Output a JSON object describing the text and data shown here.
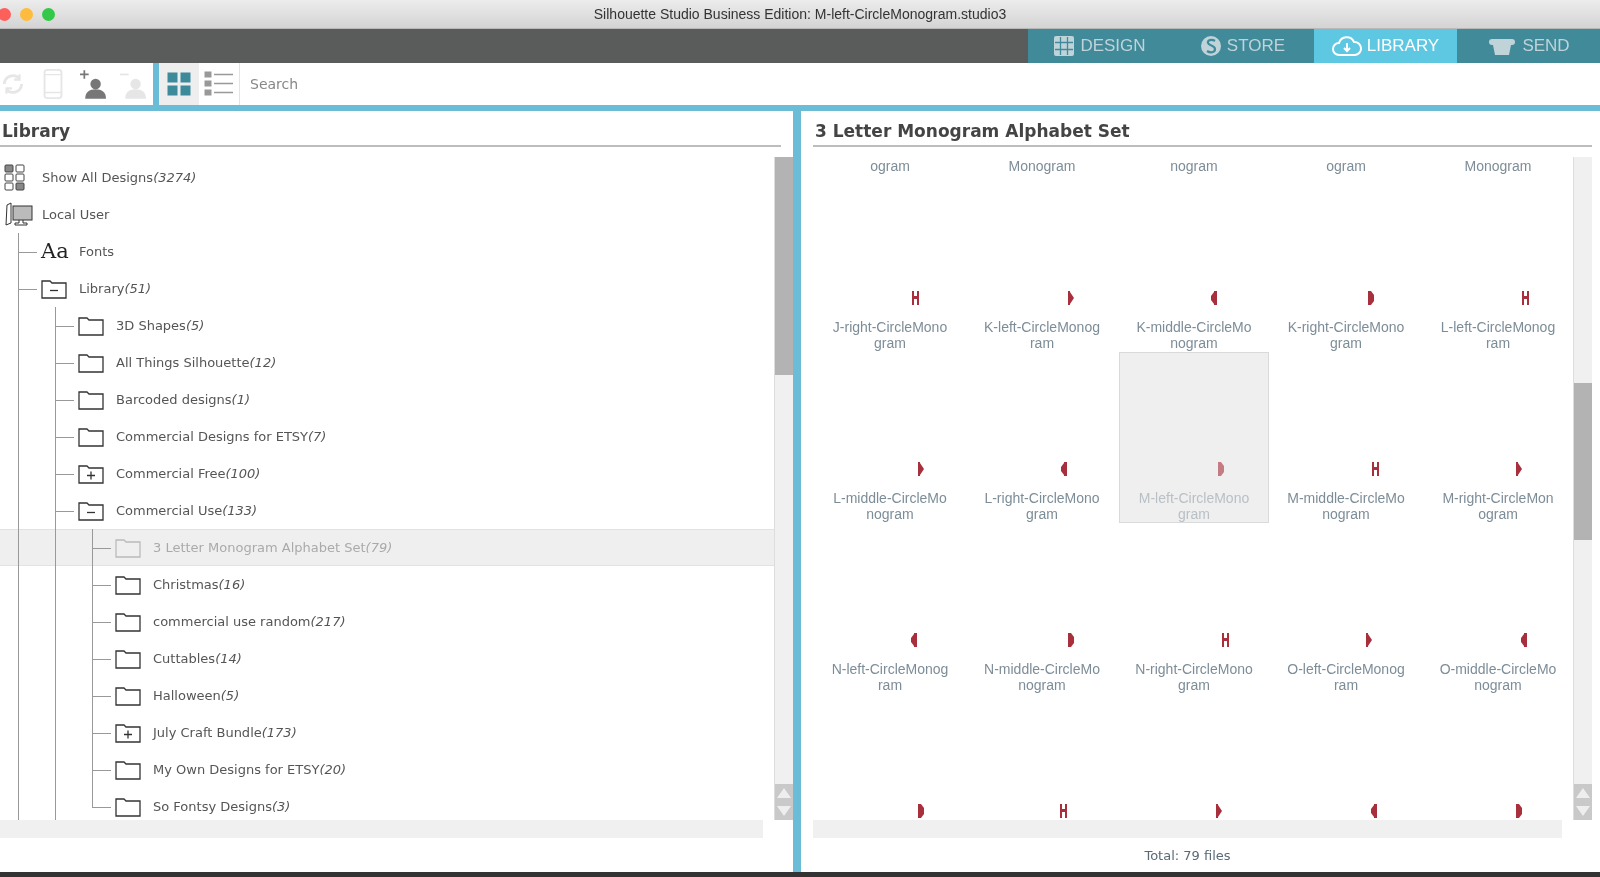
{
  "window": {
    "title": "Silhouette Studio Business Edition: M-left-CircleMonogram.studio3"
  },
  "nav_tabs": [
    {
      "label": "DESIGN",
      "kind": "design",
      "selected": false
    },
    {
      "label": "STORE",
      "kind": "store",
      "selected": false
    },
    {
      "label": "LIBRARY",
      "kind": "library",
      "selected": true
    },
    {
      "label": "SEND",
      "kind": "send",
      "selected": false
    }
  ],
  "toolbar": {
    "tools": [
      {
        "kind": "sync",
        "disabled": true
      },
      {
        "kind": "device",
        "disabled": true
      },
      {
        "kind": "add-user",
        "disabled": false
      },
      {
        "kind": "remove-user",
        "disabled": true
      }
    ],
    "views": [
      {
        "kind": "grid",
        "selected": true
      },
      {
        "kind": "list",
        "selected": false
      }
    ],
    "search": {
      "placeholder": "Search"
    }
  },
  "library_panel": {
    "title": "Library",
    "tree": [
      {
        "name": "Show All Designs",
        "count": "(3274)",
        "kind": "all",
        "selected": false
      },
      {
        "name": "Local User",
        "kind": "user",
        "selected": false,
        "children": [
          {
            "name": "Fonts",
            "kind": "fonts",
            "icon_text": "Aa",
            "selected": false
          },
          {
            "name": "Library",
            "count": "(51)",
            "kind": "folder-expanded",
            "selected": false,
            "children": [
              {
                "name": "3D Shapes",
                "count": "(5)",
                "kind": "folder",
                "selected": false
              },
              {
                "name": "All Things Silhouette",
                "count": "(12)",
                "kind": "folder",
                "selected": false
              },
              {
                "name": "Barcoded designs",
                "count": "(1)",
                "kind": "folder",
                "selected": false
              },
              {
                "name": "Commercial Designs for ETSY",
                "count": "(7)",
                "kind": "folder",
                "selected": false
              },
              {
                "name": "Commercial Free",
                "count": "(100)",
                "kind": "folder-collapsed",
                "selected": false
              },
              {
                "name": "Commercial Use",
                "count": "(133)",
                "kind": "folder-expanded",
                "selected": false,
                "children": [
                  {
                    "name": "3 Letter Monogram Alphabet Set",
                    "count": "(79)",
                    "kind": "folder",
                    "selected": true
                  },
                  {
                    "name": "Christmas",
                    "count": "(16)",
                    "kind": "folder",
                    "selected": false
                  },
                  {
                    "name": "commercial use random",
                    "count": "(217)",
                    "kind": "folder",
                    "selected": false
                  },
                  {
                    "name": "Cuttables",
                    "count": "(14)",
                    "kind": "folder",
                    "selected": false
                  },
                  {
                    "name": "Halloween",
                    "count": "(5)",
                    "kind": "folder",
                    "selected": false
                  },
                  {
                    "name": "July Craft Bundle",
                    "count": "(173)",
                    "kind": "folder-collapsed",
                    "selected": false
                  },
                  {
                    "name": "My Own Designs for ETSY",
                    "count": "(20)",
                    "kind": "folder",
                    "selected": false
                  },
                  {
                    "name": "So Fontsy Designs",
                    "count": "(3)",
                    "kind": "folder",
                    "selected": false
                  }
                ]
              }
            ]
          }
        ]
      }
    ]
  },
  "designs_panel": {
    "title": "3 Letter Monogram Alphabet Set",
    "tiles": [
      {
        "label": "ogram",
        "kind": "label-only",
        "selected": false
      },
      {
        "label": "Monogram",
        "kind": "label-only",
        "selected": false
      },
      {
        "label": "nogram",
        "kind": "label-only",
        "selected": false
      },
      {
        "label": "ogram",
        "kind": "label-only",
        "selected": false
      },
      {
        "label": "Monogram",
        "kind": "label-only",
        "selected": false
      },
      {
        "label": "J-right-CircleMonogram",
        "kind": "design",
        "selected": false
      },
      {
        "label": "K-left-CircleMonogram",
        "kind": "design",
        "selected": false
      },
      {
        "label": "K-middle-CircleMonogram",
        "kind": "design",
        "selected": false
      },
      {
        "label": "K-right-CircleMonogram",
        "kind": "design",
        "selected": false
      },
      {
        "label": "L-left-CircleMonogram",
        "kind": "design",
        "selected": false
      },
      {
        "label": "L-middle-CircleMonogram",
        "kind": "design",
        "selected": false
      },
      {
        "label": "L-right-CircleMonogram",
        "kind": "design",
        "selected": false
      },
      {
        "label": "M-left-CircleMonogram",
        "kind": "design",
        "selected": true
      },
      {
        "label": "M-middle-CircleMonogram",
        "kind": "design",
        "selected": false
      },
      {
        "label": "M-right-CircleMonogram",
        "kind": "design",
        "selected": false
      },
      {
        "label": "N-left-CircleMonogram",
        "kind": "design",
        "selected": false
      },
      {
        "label": "N-middle-CircleMonogram",
        "kind": "design",
        "selected": false
      },
      {
        "label": "N-right-CircleMonogram",
        "kind": "design",
        "selected": false
      },
      {
        "label": "O-left-CircleMonogram",
        "kind": "design",
        "selected": false
      },
      {
        "label": "O-middle-CircleMonogram",
        "kind": "design",
        "selected": false
      },
      {
        "kind": "thumbnail-only",
        "selected": false
      },
      {
        "kind": "thumbnail-only",
        "selected": false
      },
      {
        "kind": "thumbnail-only",
        "selected": false
      },
      {
        "kind": "thumbnail-only",
        "selected": false
      },
      {
        "kind": "thumbnail-only",
        "selected": false
      }
    ],
    "total": "Total: 79 files"
  }
}
